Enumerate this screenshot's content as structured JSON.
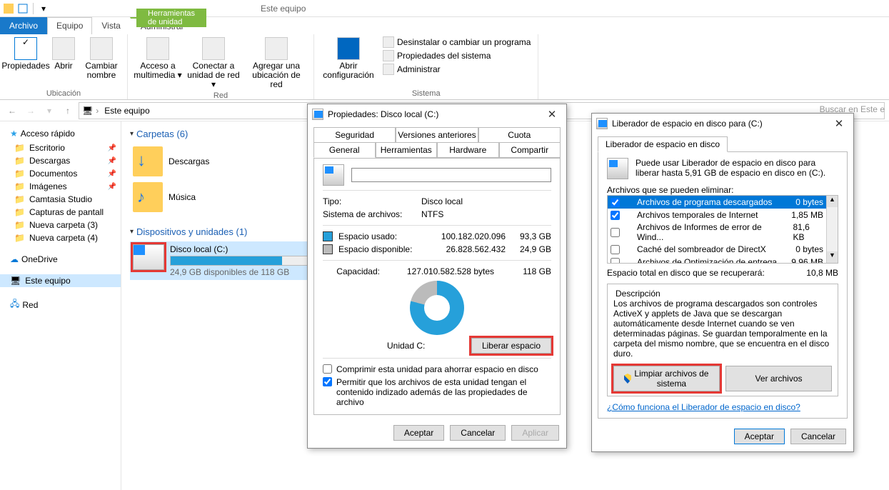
{
  "window": {
    "contextual_tab_group": "Herramientas de unidad",
    "context_title": "Este equipo",
    "tabs": [
      "Archivo",
      "Equipo",
      "Vista"
    ],
    "contextual_tab": "Administrar"
  },
  "ribbon": {
    "location": {
      "caption": "Ubicación",
      "props": "Propiedades",
      "open": "Abrir",
      "rename": "Cambiar nombre"
    },
    "network": {
      "caption": "Red",
      "media": "Acceso a multimedia",
      "netdrive": "Conectar a unidad de red",
      "addloc": "Agregar una ubicación de red"
    },
    "system": {
      "caption": "Sistema",
      "opensettings": "Abrir configuración",
      "uninstall": "Desinstalar o cambiar un programa",
      "sysprops": "Propiedades del sistema",
      "admin": "Administrar"
    }
  },
  "address": {
    "root": "Este equipo"
  },
  "search_placeholder": "Buscar en Este e",
  "nav": {
    "quick": "Acceso rápido",
    "items": [
      {
        "label": "Escritorio",
        "pin": true
      },
      {
        "label": "Descargas",
        "pin": true
      },
      {
        "label": "Documentos",
        "pin": true
      },
      {
        "label": "Imágenes",
        "pin": true
      },
      {
        "label": "Camtasia Studio",
        "pin": false
      },
      {
        "label": "Capturas de pantall",
        "pin": false
      },
      {
        "label": "Nueva carpeta (3)",
        "pin": false
      },
      {
        "label": "Nueva carpeta (4)",
        "pin": false
      }
    ],
    "onedrive": "OneDrive",
    "thispc": "Este equipo",
    "network": "Red"
  },
  "main": {
    "folders_hdr": "Carpetas (6)",
    "downloads": "Descargas",
    "music": "Música",
    "drives_hdr": "Dispositivos y unidades (1)",
    "drive_name": "Disco local (C:)",
    "drive_sub": "24,9 GB disponibles de 118 GB",
    "drive_fill_pct": 79
  },
  "propDlg": {
    "title": "Propiedades: Disco local (C:)",
    "tabs_top": [
      "Seguridad",
      "Versiones anteriores",
      "Cuota"
    ],
    "tabs_bot": [
      "General",
      "Herramientas",
      "Hardware",
      "Compartir"
    ],
    "type_k": "Tipo:",
    "type_v": "Disco local",
    "fs_k": "Sistema de archivos:",
    "fs_v": "NTFS",
    "used_k": "Espacio usado:",
    "used_bytes": "100.182.020.096",
    "used_h": "93,3 GB",
    "free_k": "Espacio disponible:",
    "free_bytes": "26.828.562.432",
    "free_h": "24,9 GB",
    "cap_k": "Capacidad:",
    "cap_bytes": "127.010.582.528 bytes",
    "cap_h": "118 GB",
    "unit": "Unidad C:",
    "cleanup_btn": "Liberar espacio",
    "compress": "Comprimir esta unidad para ahorrar espacio en disco",
    "index": "Permitir que los archivos de esta unidad tengan el contenido indizado además de las propiedades de archivo",
    "ok": "Aceptar",
    "cancel": "Cancelar",
    "apply": "Aplicar"
  },
  "cleanDlg": {
    "title": "Liberador de espacio en disco para  (C:)",
    "tab": "Liberador de espacio en disco",
    "intro": "Puede usar Liberador de espacio en disco para liberar hasta 5,91 GB de espacio en disco en  (C:).",
    "list_label": "Archivos que se pueden eliminar:",
    "items": [
      {
        "checked": true,
        "label": "Archivos de programa descargados",
        "size": "0 bytes",
        "sel": true
      },
      {
        "checked": true,
        "label": "Archivos temporales de Internet",
        "size": "1,85 MB"
      },
      {
        "checked": false,
        "label": "Archivos de Informes de error de Wind...",
        "size": "81,6 KB"
      },
      {
        "checked": false,
        "label": "Caché del sombreador de DirectX",
        "size": "0 bytes"
      },
      {
        "checked": false,
        "label": "Archivos de Optimización de entrega",
        "size": "9,96 MB"
      }
    ],
    "total_k": "Espacio total en disco que se recuperará:",
    "total_v": "10,8 MB",
    "desc_legend": "Descripción",
    "desc_text": "Los archivos de programa descargados son controles ActiveX y applets de Java que se descargan automáticamente desde Internet cuando se ven determinadas páginas. Se guardan temporalmente en la carpeta del mismo nombre, que se encuentra en el disco duro.",
    "sysfiles_btn": "Limpiar archivos de sistema",
    "viewfiles_btn": "Ver archivos",
    "help_link": "¿Cómo funciona el Liberador de espacio en disco?",
    "ok": "Aceptar",
    "cancel": "Cancelar"
  }
}
